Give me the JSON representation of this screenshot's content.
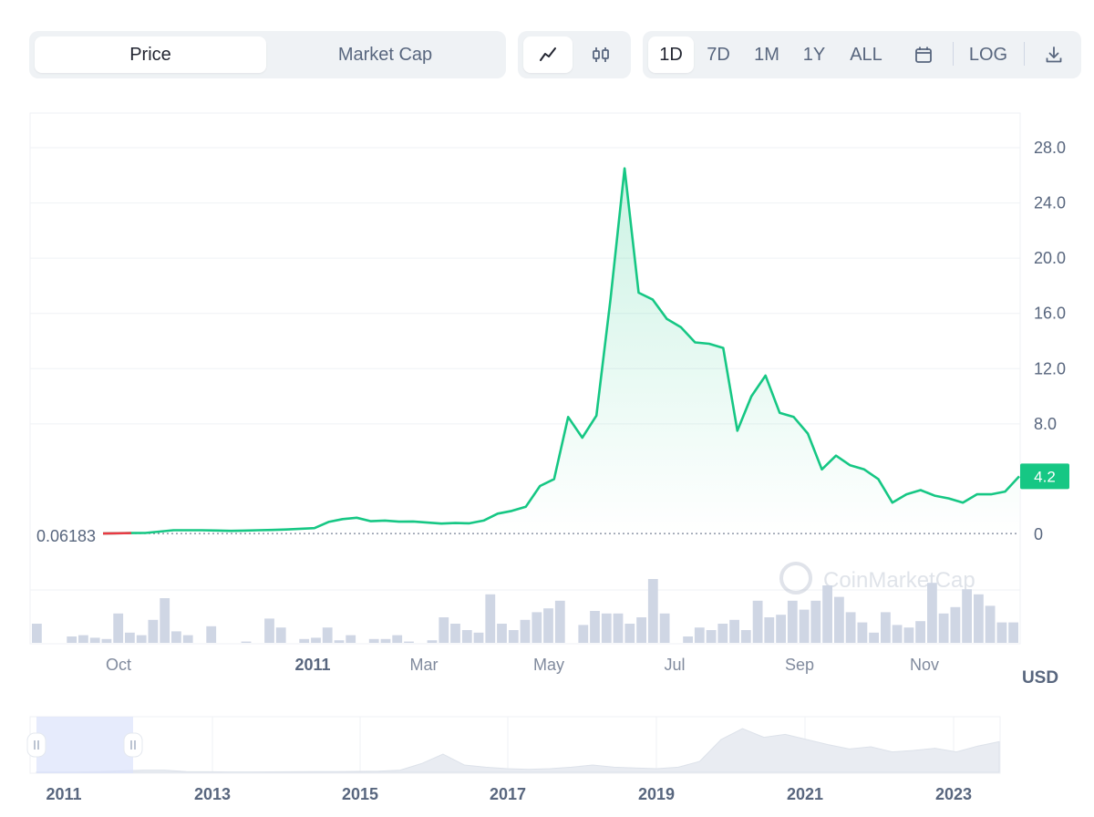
{
  "tabs": {
    "price": "Price",
    "market_cap": "Market Cap"
  },
  "chart_type_icons": [
    "line-chart-icon",
    "candlestick-icon"
  ],
  "ranges": [
    "1D",
    "7D",
    "1M",
    "1Y",
    "ALL"
  ],
  "active_range": "1D",
  "log_label": "LOG",
  "icons": {
    "calendar": "calendar-icon",
    "download": "download-icon"
  },
  "watermark": "CoinMarketCap",
  "currency": "USD",
  "colors": {
    "line": "#16c784",
    "accent_label": "#16c784",
    "volume": "#cfd6e4",
    "baseline_line": "#ea3943"
  },
  "chart_data": {
    "type": "line",
    "start_label": "0.06183",
    "current_label": "4.2",
    "y_ticks": [
      "28.0",
      "24.0",
      "20.0",
      "16.0",
      "12.0",
      "8.0",
      "0"
    ],
    "x_ticks": [
      "Oct",
      "2011",
      "Mar",
      "May",
      "Jul",
      "Sep",
      "Nov"
    ],
    "ylim": [
      -0.1,
      28.0
    ],
    "series": [
      {
        "values": [
          0.06,
          0.08,
          0.09,
          0.1,
          0.2,
          0.3,
          0.3,
          0.3,
          0.28,
          0.25,
          0.27,
          0.3,
          0.32,
          0.35,
          0.4,
          0.45,
          0.9,
          1.1,
          1.2,
          0.95,
          1.0,
          0.92,
          0.93,
          0.85,
          0.78,
          0.82,
          0.8,
          1.0,
          1.5,
          1.7,
          2.0,
          3.5,
          4.0,
          8.5,
          7.0,
          8.6,
          17.0,
          26.5,
          17.5,
          17.0,
          15.6,
          15.0,
          13.9,
          13.8,
          13.5,
          7.5,
          10.0,
          11.5,
          8.8,
          8.5,
          7.3,
          4.7,
          5.7,
          5.0,
          4.7,
          4.0,
          2.3,
          2.9,
          3.2,
          2.8,
          2.6,
          2.3,
          2.9,
          2.9,
          3.1,
          4.2
        ]
      }
    ],
    "volume": [
      1.5,
      0,
      0,
      0.5,
      0.6,
      0.4,
      0.3,
      2.3,
      0.8,
      0.6,
      1.8,
      3.5,
      0.9,
      0.6,
      0,
      1.3,
      0,
      0,
      0.1,
      0,
      1.9,
      1.2,
      0,
      0.3,
      0.4,
      1.2,
      0.2,
      0.6,
      0,
      0.3,
      0.3,
      0.6,
      0.1,
      0,
      0.2,
      2.0,
      1.5,
      1.0,
      0.8,
      3.8,
      1.5,
      1.0,
      1.8,
      2.4,
      2.7,
      3.3,
      0,
      1.4,
      2.5,
      2.3,
      2.3,
      1.5,
      2.0,
      5.0,
      2.3,
      0,
      0.5,
      1.2,
      1.0,
      1.5,
      1.8,
      1.0,
      3.3,
      2.0,
      2.2,
      3.3,
      2.6,
      3.3,
      4.5,
      3.6,
      2.4,
      1.6,
      0.8,
      2.4,
      1.4,
      1.2,
      1.7,
      4.7,
      2.3,
      2.8,
      4.2,
      3.8,
      2.9,
      1.6,
      1.6
    ],
    "navigator": {
      "x_ticks": [
        "2011",
        "2013",
        "2015",
        "2017",
        "2019",
        "2021",
        "2023"
      ],
      "values": [
        0.02,
        0.02,
        0.05,
        0.1,
        0.2,
        0.3,
        0.3,
        0.1,
        0.08,
        0.05,
        0.05,
        0.06,
        0.08,
        0.09,
        0.1,
        0.12,
        0.15,
        0.3,
        1.2,
        2.5,
        1.0,
        0.7,
        0.5,
        0.4,
        0.5,
        0.7,
        1.0,
        0.7,
        0.6,
        0.5,
        0.7,
        1.5,
        4.5,
        6.0,
        4.8,
        5.2,
        4.5,
        3.8,
        3.2,
        3.5,
        2.8,
        3.0,
        3.3,
        2.8,
        3.6,
        4.2
      ]
    }
  }
}
